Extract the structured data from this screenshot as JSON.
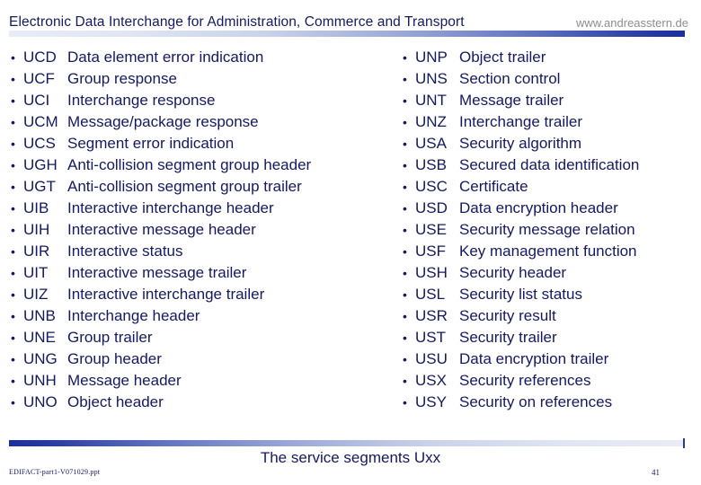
{
  "header": {
    "title": "Electronic Data Interchange for Administration, Commerce and Transport",
    "url": "www.andreasstern.de"
  },
  "colors": {
    "text_navy": "#15195e",
    "url_gray": "#8d8d8d",
    "rule_dark": "#1b2e9c",
    "rule_light": "#e8ecf6"
  },
  "content": {
    "bullet_glyph": "•",
    "left_column": [
      {
        "code": "UCD",
        "desc": "Data element error indication"
      },
      {
        "code": "UCF",
        "desc": "Group response"
      },
      {
        "code": "UCI",
        "desc": "Interchange response"
      },
      {
        "code": "UCM",
        "desc": "Message/package response"
      },
      {
        "code": "UCS",
        "desc": "Segment error indication"
      },
      {
        "code": "UGH",
        "desc": "Anti-collision segment group header"
      },
      {
        "code": "UGT",
        "desc": "Anti-collision segment group trailer"
      },
      {
        "code": "UIB",
        "desc": "Interactive interchange header"
      },
      {
        "code": "UIH",
        "desc": "Interactive message header"
      },
      {
        "code": "UIR",
        "desc": "Interactive status"
      },
      {
        "code": "UIT",
        "desc": "Interactive message trailer"
      },
      {
        "code": "UIZ",
        "desc": "Interactive interchange trailer"
      },
      {
        "code": "UNB",
        "desc": "Interchange header"
      },
      {
        "code": "UNE",
        "desc": "Group trailer"
      },
      {
        "code": "UNG",
        "desc": "Group header"
      },
      {
        "code": "UNH",
        "desc": "Message header"
      },
      {
        "code": "UNO",
        "desc": "Object header"
      }
    ],
    "right_column": [
      {
        "code": "UNP",
        "desc": "Object trailer"
      },
      {
        "code": "UNS",
        "desc": "Section control"
      },
      {
        "code": "UNT",
        "desc": "Message trailer"
      },
      {
        "code": "UNZ",
        "desc": "Interchange trailer"
      },
      {
        "code": "USA",
        "desc": "Security algorithm"
      },
      {
        "code": "USB",
        "desc": "Secured data identification"
      },
      {
        "code": "USC",
        "desc": "Certificate"
      },
      {
        "code": "USD",
        "desc": "Data encryption header"
      },
      {
        "code": "USE",
        "desc": "Security message relation"
      },
      {
        "code": "USF",
        "desc": "Key management function"
      },
      {
        "code": "USH",
        "desc": "Security header"
      },
      {
        "code": "USL",
        "desc": "Security list status"
      },
      {
        "code": "USR",
        "desc": "Security result"
      },
      {
        "code": "UST",
        "desc": "Security trailer"
      },
      {
        "code": "USU",
        "desc": "Data encryption trailer"
      },
      {
        "code": "USX",
        "desc": "Security references"
      },
      {
        "code": "USY",
        "desc": "Security on references"
      }
    ]
  },
  "footer": {
    "subtitle": "The service segments Uxx",
    "file": "EDIFACT-part1-V071029.ppt",
    "page": "41"
  }
}
